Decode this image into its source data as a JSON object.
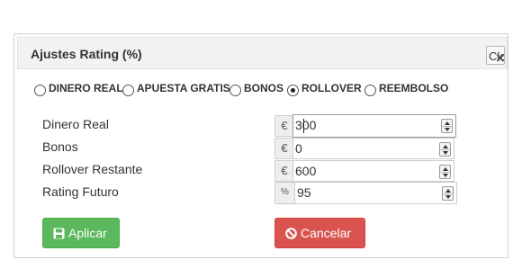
{
  "dialog": {
    "title": "Ajustes Rating (%)",
    "close_label": "Close",
    "close_glyph": "×"
  },
  "options": [
    {
      "label": "DINERO REAL",
      "checked": false
    },
    {
      "label": "APUESTA GRATIS",
      "checked": false
    },
    {
      "label": "BONOS",
      "checked": false
    },
    {
      "label": "ROLLOVER",
      "checked": true
    },
    {
      "label": "REEMBOLSO",
      "checked": false
    }
  ],
  "fields": [
    {
      "label": "Dinero Real",
      "addon": "€",
      "value": "300"
    },
    {
      "label": "Bonos",
      "addon": "€",
      "value": "0"
    },
    {
      "label": "Rollover Restante",
      "addon": "€",
      "value": "600"
    },
    {
      "label": "Rating Futuro",
      "addon": "%",
      "value": "95"
    }
  ],
  "buttons": {
    "apply_label": "Aplicar",
    "apply_icon": "save-icon",
    "apply_color": "#5cb85c",
    "cancel_label": "Cancelar",
    "cancel_icon": "ban-icon",
    "cancel_color": "#d9534f"
  }
}
